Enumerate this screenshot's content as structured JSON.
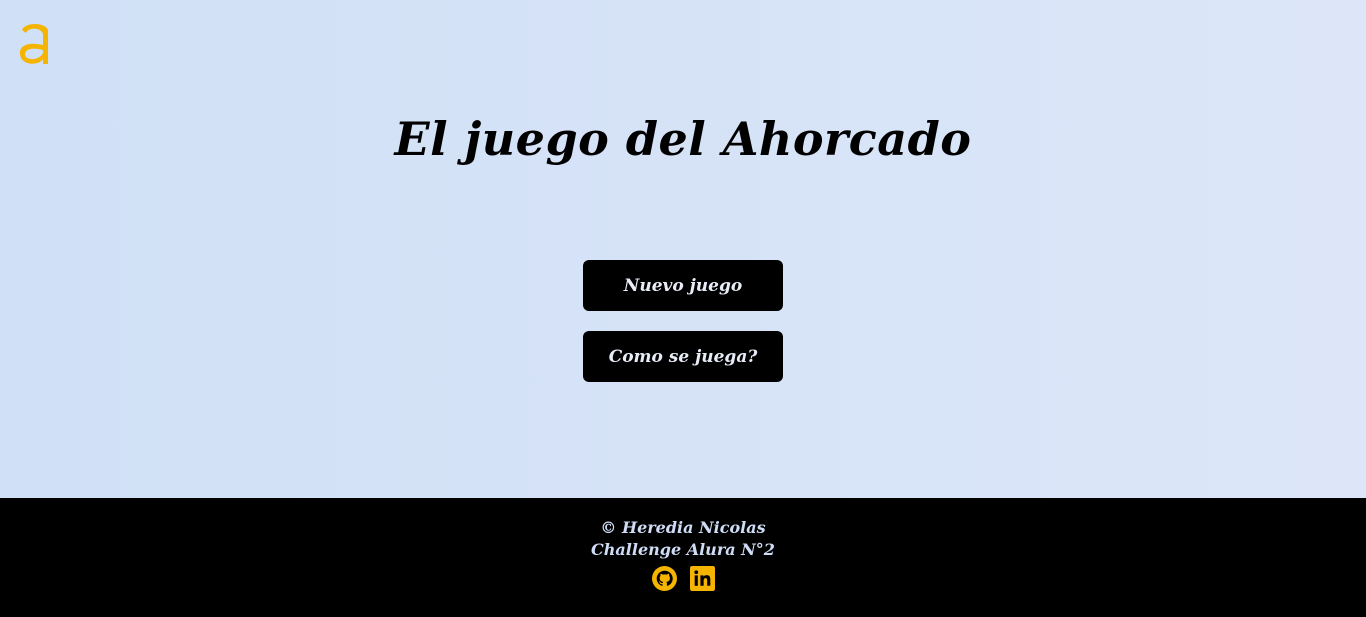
{
  "header": {
    "logo_icon": "alura-a-logo-icon",
    "logo_color": "#f5b400"
  },
  "main": {
    "title": "El juego del Ahorcado",
    "new_game_label": "Nuevo juego",
    "how_to_play_label": "Como se juega?"
  },
  "footer": {
    "author": "© Heredia Nicolas",
    "challenge": "Challenge Alura N°2",
    "links": [
      {
        "icon": "github-icon"
      },
      {
        "icon": "linkedin-icon"
      }
    ],
    "accent": "#f5b400"
  }
}
